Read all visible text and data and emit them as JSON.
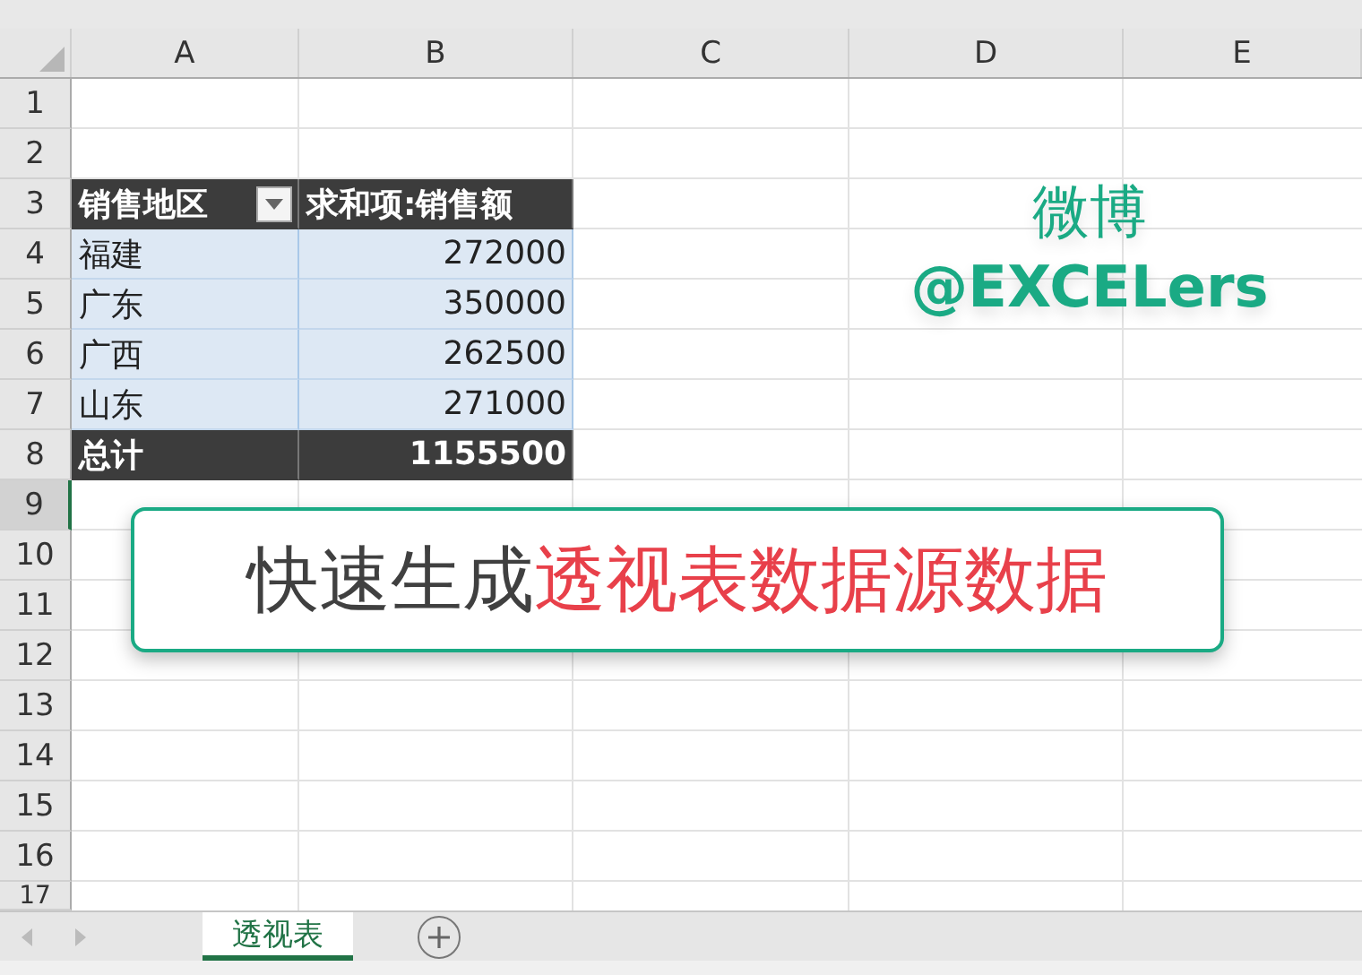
{
  "columns": [
    "A",
    "B",
    "C",
    "D",
    "E"
  ],
  "rows": [
    {
      "label": "1",
      "selected": false
    },
    {
      "label": "2",
      "selected": false
    },
    {
      "label": "3",
      "selected": false
    },
    {
      "label": "4",
      "selected": false
    },
    {
      "label": "5",
      "selected": false
    },
    {
      "label": "6",
      "selected": false
    },
    {
      "label": "7",
      "selected": false
    },
    {
      "label": "8",
      "selected": false
    },
    {
      "label": "9",
      "selected": true
    },
    {
      "label": "10",
      "selected": false
    },
    {
      "label": "11",
      "selected": false
    },
    {
      "label": "12",
      "selected": false
    },
    {
      "label": "13",
      "selected": false
    },
    {
      "label": "14",
      "selected": false
    },
    {
      "label": "15",
      "selected": false
    },
    {
      "label": "16",
      "selected": false
    },
    {
      "label": "17",
      "selected": false
    }
  ],
  "pivot": {
    "header": [
      "销售地区",
      "求和项:销售额"
    ],
    "rows": [
      [
        "福建",
        "272000"
      ],
      [
        "广东",
        "350000"
      ],
      [
        "广西",
        "262500"
      ],
      [
        "山东",
        "271000"
      ]
    ],
    "total": [
      "总计",
      "1155500"
    ]
  },
  "brand_label": {
    "line_1": "微博",
    "line_2": "@EXCELers"
  },
  "banner": {
    "parts": [
      {
        "text": "快速生成",
        "color": "#404040"
      },
      {
        "text": "透视表数据源数据",
        "color": "#e8404a"
      }
    ]
  },
  "sheet_tabs": [
    {
      "label": "透视表",
      "selected": true
    }
  ]
}
